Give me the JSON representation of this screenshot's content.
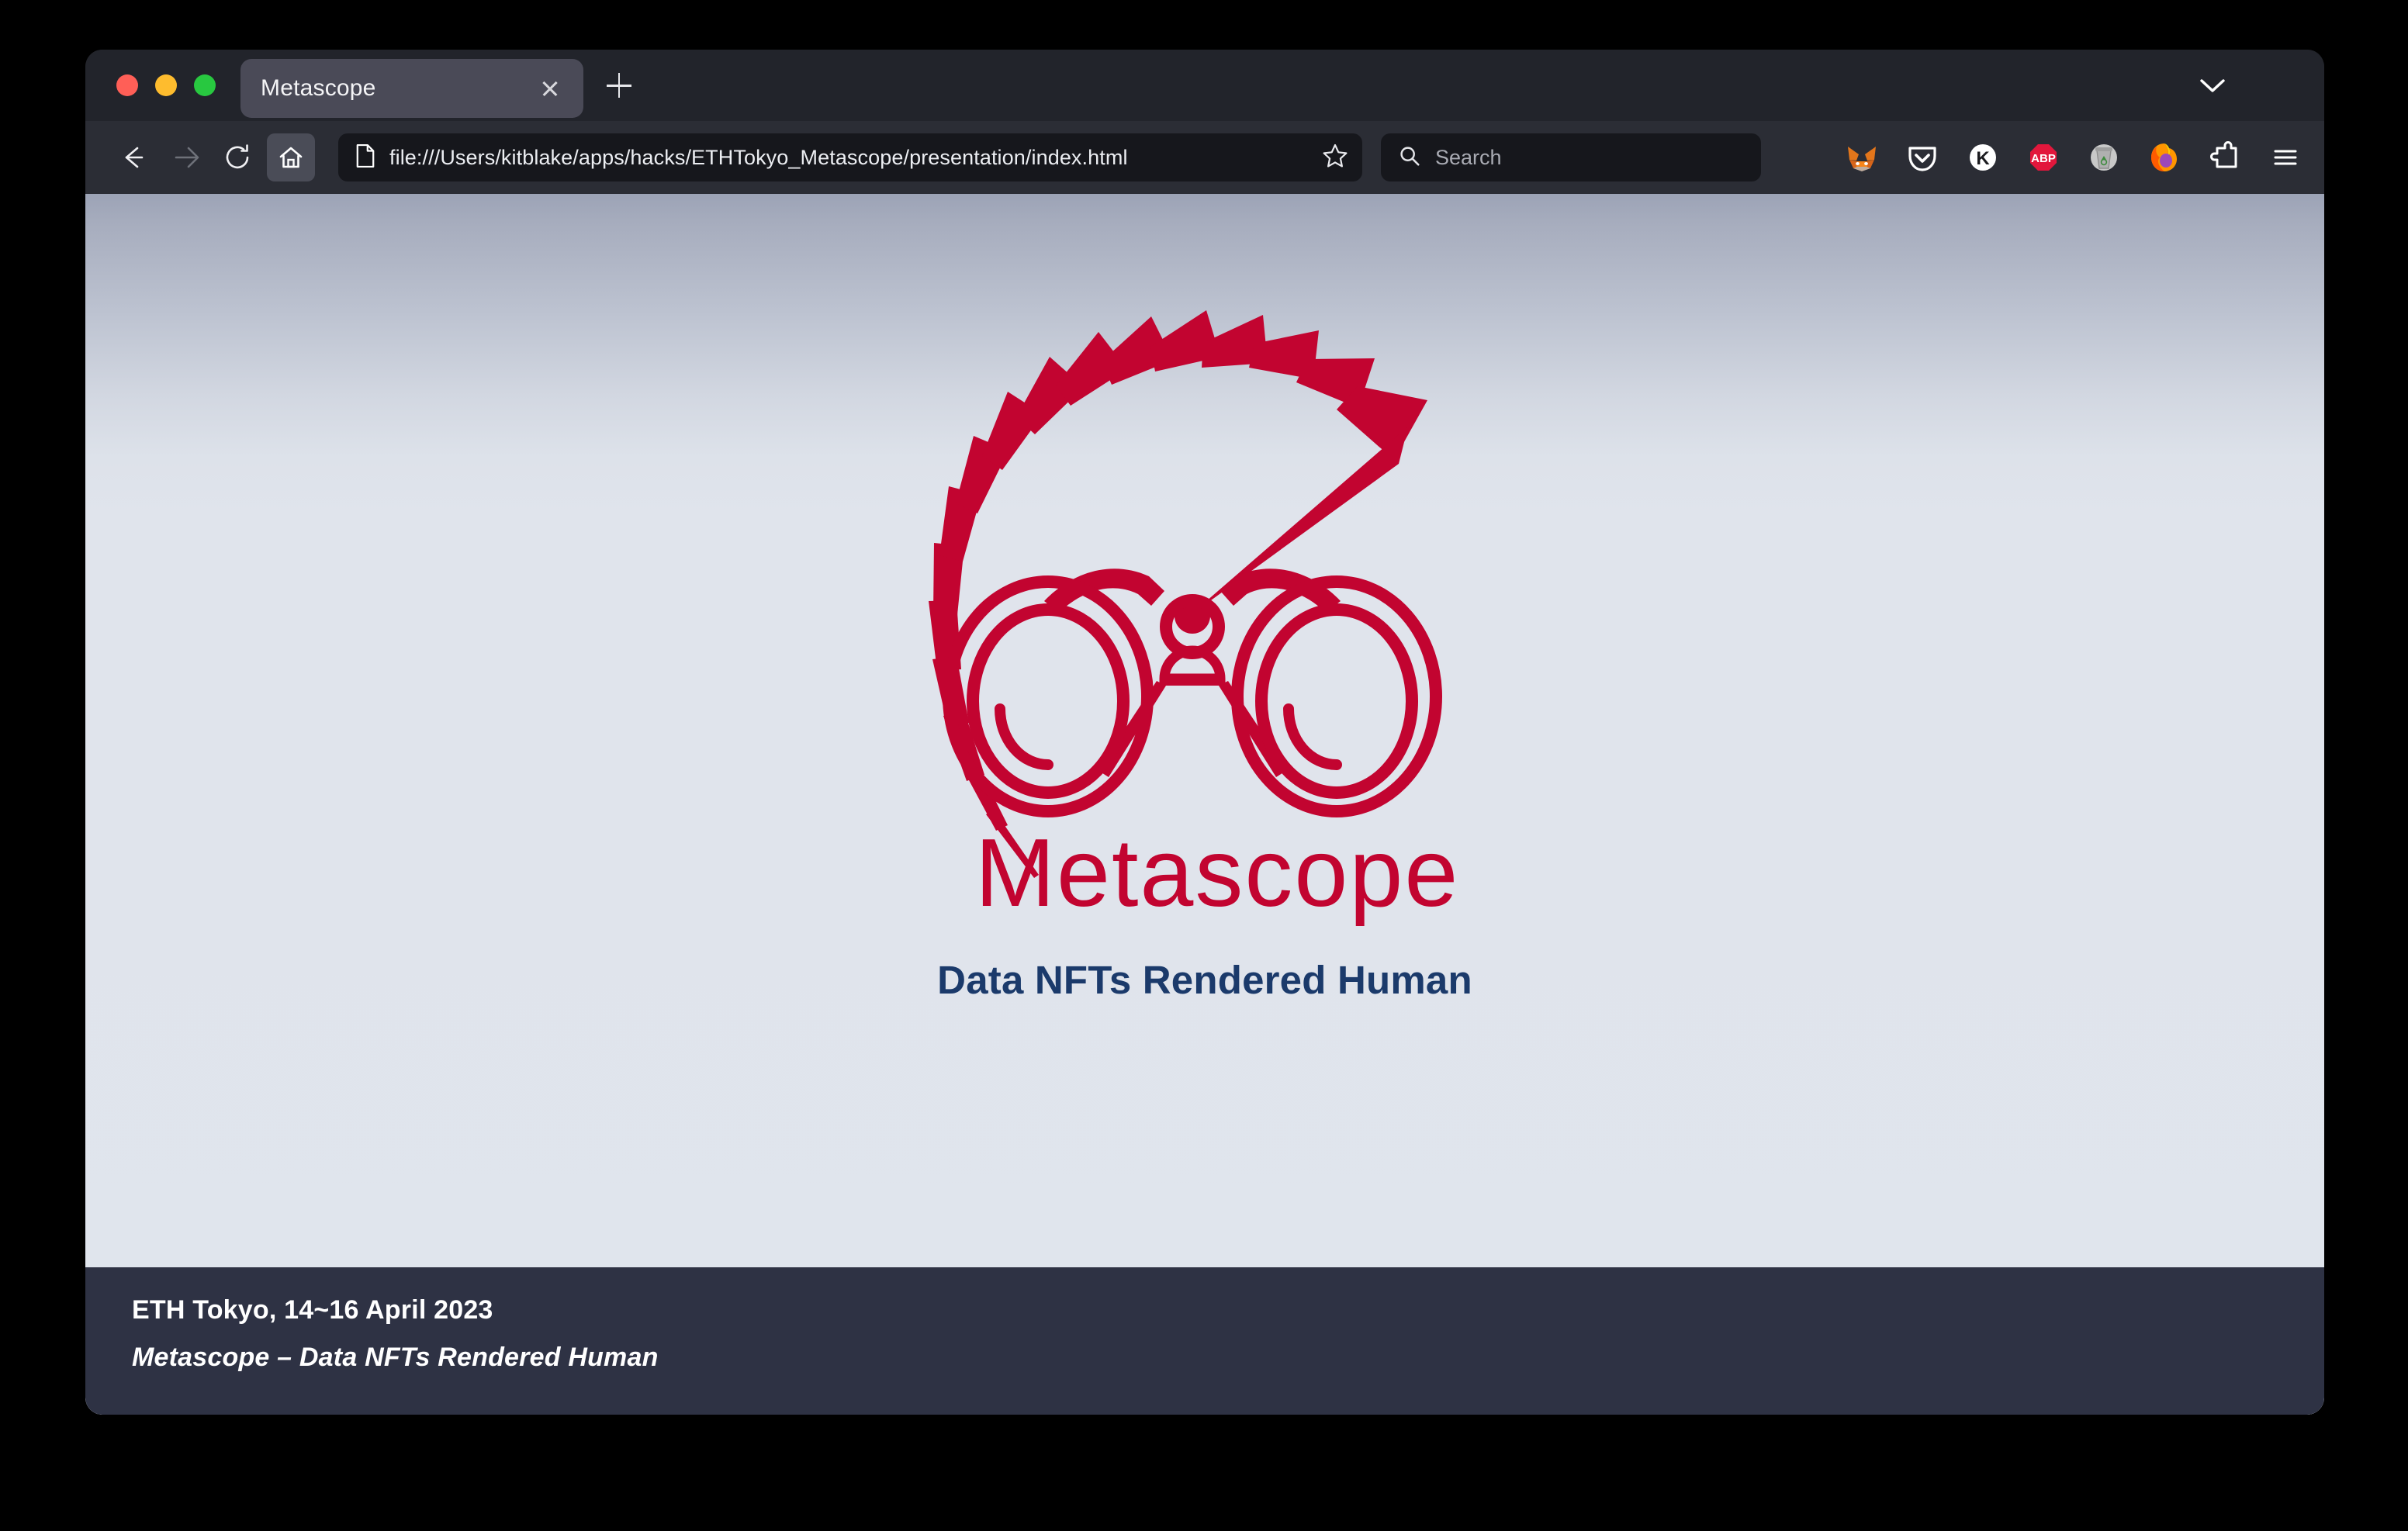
{
  "window": {
    "traffic_lights": [
      {
        "name": "close",
        "color": "#ff5f57"
      },
      {
        "name": "minimize",
        "color": "#febc2e"
      },
      {
        "name": "maximize",
        "color": "#28c840"
      }
    ]
  },
  "tabs": {
    "items": [
      {
        "title": "Metascope",
        "active": true
      }
    ],
    "new_tab_label": "+",
    "overflow_label": "List all tabs"
  },
  "toolbar": {
    "back_label": "Back",
    "forward_label": "Forward",
    "reload_label": "Reload",
    "home_label": "Home",
    "url": "file:///Users/kitblake/apps/hacks/ETHTokyo_Metascope/presentation/index.html",
    "bookmark_label": "Bookmark this page",
    "search_placeholder": "Search",
    "extensions": [
      {
        "name": "metamask-icon",
        "label": "MetaMask"
      },
      {
        "name": "pocket-icon",
        "label": "Pocket"
      },
      {
        "name": "keplr-icon",
        "label": "K"
      },
      {
        "name": "adblock-plus-icon",
        "label": "ABP"
      },
      {
        "name": "trash-icon",
        "label": "Recycle"
      },
      {
        "name": "firefox-icon",
        "label": "Firefox"
      },
      {
        "name": "puzzle-icon",
        "label": "Extensions"
      },
      {
        "name": "menu-icon",
        "label": "Open application menu"
      }
    ]
  },
  "slide": {
    "logo_alt": "Metascope",
    "logo_wordmark": "Metascope",
    "brand_color": "#c20430",
    "tagline": "Data NFTs Rendered Human",
    "footer_line_1": "ETH Tokyo, 14~16 April 2023",
    "footer_line_2": "Metascope – Data NFTs Rendered Human",
    "background_top": "#9ca3b6",
    "background_bottom": "#e0e5ed",
    "footer_background": "#2e3244",
    "tagline_color": "#1b3a6b"
  }
}
